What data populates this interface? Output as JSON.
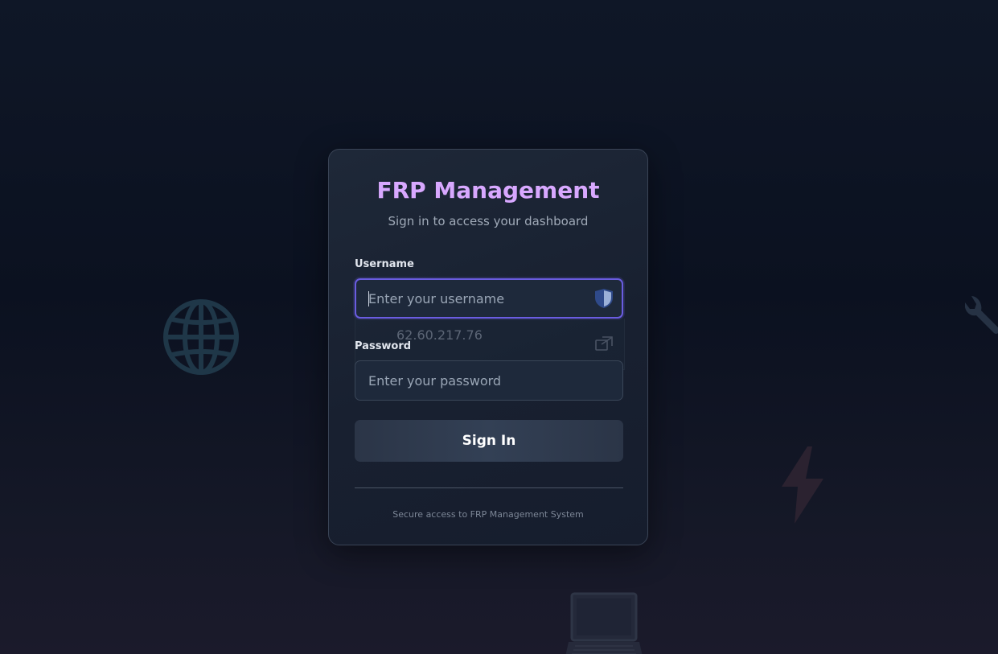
{
  "login": {
    "title": "FRP Management",
    "subtitle": "Sign in to access your dashboard",
    "username": {
      "label": "Username",
      "placeholder": "Enter your username",
      "value": ""
    },
    "password": {
      "label": "Password",
      "placeholder": "Enter your password",
      "value": ""
    },
    "autofill_suggestion": "62.60.217.76",
    "submit_label": "Sign In",
    "footer": "Secure access to FRP Management System"
  },
  "colors": {
    "title": "#d8a8ff",
    "focus_border": "#6a5ce0",
    "background": "#0b1120",
    "card": "#1a2333",
    "button": "#2f3a4d"
  },
  "icons": {
    "background": [
      "globe-icon",
      "wrench-icon",
      "lightning-bolt-icon",
      "laptop-icon"
    ],
    "field": [
      "password-manager-shield-icon",
      "open-external-icon"
    ]
  }
}
